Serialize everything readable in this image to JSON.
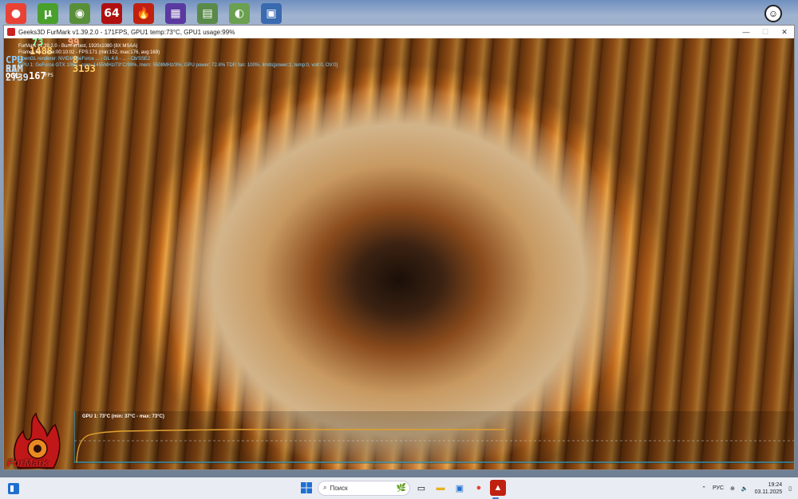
{
  "desktop": {
    "icons": [
      {
        "name": "chrome",
        "glyph": "●",
        "bg": "#e94235"
      },
      {
        "name": "utorrent",
        "glyph": "μ",
        "bg": "#4aa02c"
      },
      {
        "name": "globe-tool",
        "glyph": "◉",
        "bg": "#5a8f3a"
      },
      {
        "name": "aida64",
        "glyph": "64",
        "bg": "#b01010"
      },
      {
        "name": "furmark",
        "glyph": "🔥",
        "bg": "#c02010"
      },
      {
        "name": "vm-tool",
        "glyph": "▦",
        "bg": "#5a3aa0"
      },
      {
        "name": "map-tool",
        "glyph": "▤",
        "bg": "#5a8a4a"
      },
      {
        "name": "disk-tool",
        "glyph": "◐",
        "bg": "#6aa050"
      },
      {
        "name": "network-tool",
        "glyph": "▣",
        "bg": "#3a6ab0"
      }
    ]
  },
  "window": {
    "title": "Geeks3D FurMark v1.39.2.0 - 171FPS, GPU1 temp:73°C, GPU1 usage:99%",
    "minimize": "—",
    "maximize": "☐",
    "close": "✕"
  },
  "osd": {
    "stack_top": "73",
    "stack_right": "99",
    "stack_gpu_freq": "1488",
    "stack_cpu": "CPU 35",
    "stack_cpu_right": "8 3193",
    "stack_ram": "RAM 2739",
    "ogl_label": "OGL",
    "fps_value": "167",
    "fps_unit": "FPS",
    "line1": "FurMark v1.39.2.0 - Burn-in test, 1920x1080 (8X MSAA)",
    "line2": "Frames:58 - time:00:10:02 - FPS:171 (min:152, max:176, avg:169)",
    "line3": "OpenGL renderer: NVIDIA GeForce ... - GL:4.6 - ... - Cb/SSE2",
    "line4": "GPU 1: GeForce GTX 1060 - core: 1455MHz/73°C/99%, mem: 5508MHz/3%, GPU power: 72.8% TDP, fan: 100%, limits[power:1, temp:0, volt:0, OV:0]",
    "graph_label": "GPU 1: 73°C (min: 37°C - max: 73°C)",
    "logo_text": "FurMark"
  },
  "taskbar": {
    "search_placeholder": "Поиск",
    "language": "РУС",
    "time": "19:24",
    "date": "03.11.2025",
    "accent": "#3a7bd5"
  }
}
